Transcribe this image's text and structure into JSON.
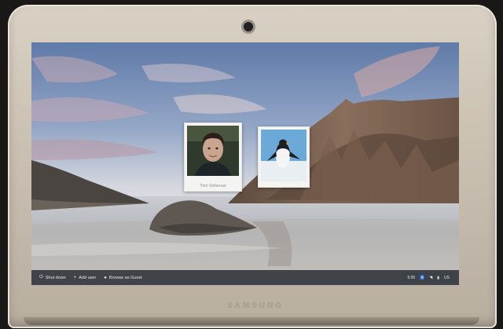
{
  "device": {
    "brand": "SAMSUNG"
  },
  "login": {
    "users": [
      {
        "name": "Tom Deleeuw",
        "avatar": "user-photo"
      },
      {
        "name": "",
        "avatar": "penguin-avatar"
      }
    ]
  },
  "taskbar": {
    "shutdown_label": "Shut down",
    "add_user_label": "Add user",
    "guest_label": "Browse as Guest",
    "time": "5:00",
    "locale": "US"
  },
  "colors": {
    "taskbar_bg": "#1c2028",
    "pod_bg": "#f4f4f2",
    "sky_top": "#6f88b0"
  }
}
